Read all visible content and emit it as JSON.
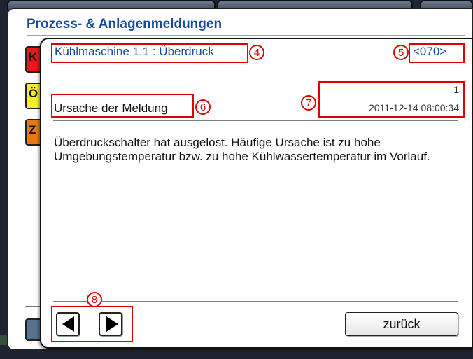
{
  "window": {
    "title": "Prozess- & Anlagenmeldungen",
    "chips": [
      "K",
      "Ö",
      "Z"
    ],
    "chip_colors": [
      "#e81818",
      "#f3f02a",
      "#e8790e"
    ]
  },
  "dialog": {
    "title": "Kühlmaschine 1.1 : Überdruck",
    "code": "<070>",
    "cause_label": "Ursache der Meldung",
    "count": "1",
    "timestamp": "2011-12-14 08:00:34",
    "description": "Überdruckschalter hat ausgelöst. Häufige Ursache ist zu hohe Umgebungstemperatur bzw. zu hohe Kühlwassertemperatur im Vorlauf.",
    "back_label": "zurück",
    "prev_icon": "triangle-left-icon",
    "next_icon": "triangle-right-icon"
  },
  "annotations": [
    "4",
    "5",
    "6",
    "7",
    "8"
  ],
  "colors": {
    "accent": "#17499e",
    "annotation": "#e00000"
  }
}
